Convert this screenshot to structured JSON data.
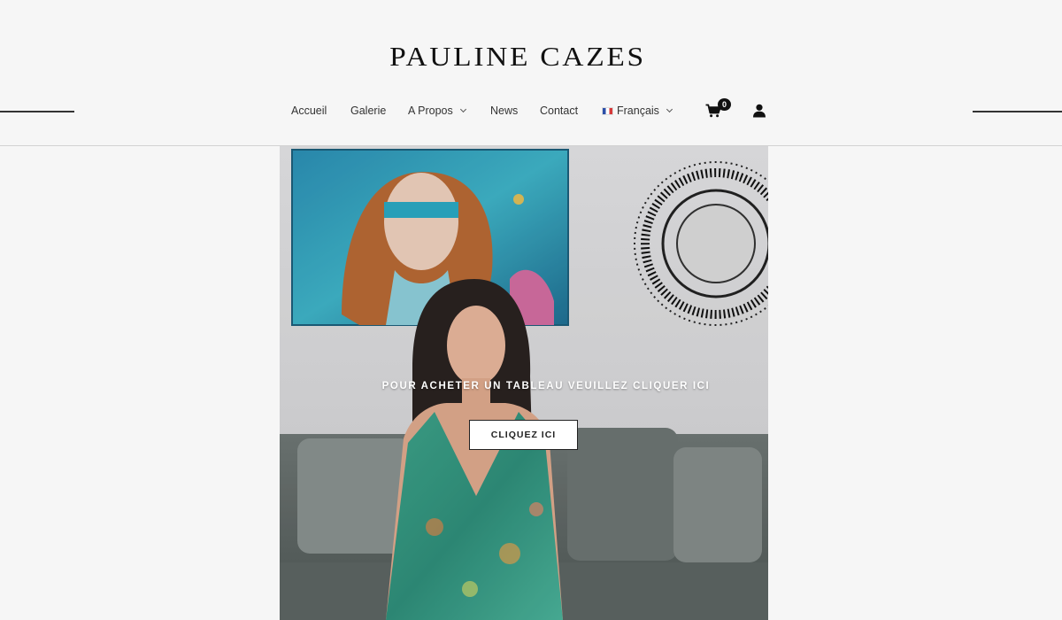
{
  "site": {
    "title": "PAULINE CAZES"
  },
  "nav": {
    "items": [
      {
        "label": "Accueil"
      },
      {
        "label": "Galerie"
      },
      {
        "label": "A Propos"
      },
      {
        "label": "News"
      },
      {
        "label": "Contact"
      },
      {
        "label": "Français"
      }
    ]
  },
  "cart": {
    "count": "0",
    "icon": "shopping-cart-icon"
  },
  "account": {
    "icon": "user-icon"
  },
  "hero": {
    "cta_text": "POUR ACHETER UN TABLEAU VEUILLEZ CLIQUER ICI",
    "button_label": "CLIQUEZ ICI"
  },
  "colors": {
    "background": "#f6f6f6",
    "text": "#222222",
    "accent": "#111111"
  }
}
